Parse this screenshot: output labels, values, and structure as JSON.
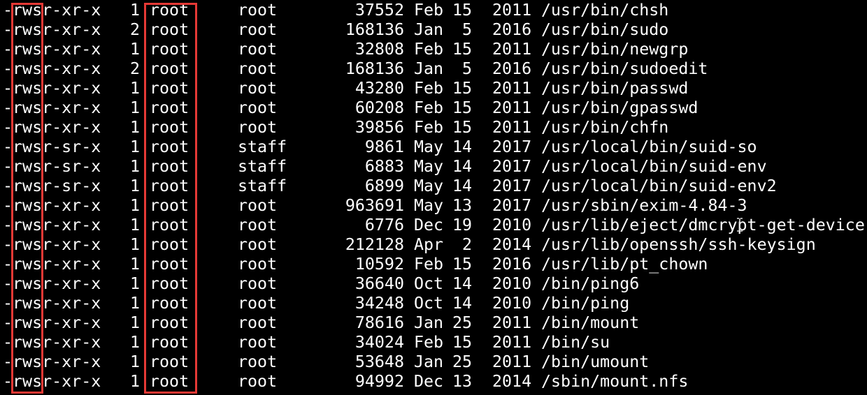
{
  "terminal": {
    "colors": {
      "background": "#000000",
      "text": "#ffffff",
      "highlight": "#e53935"
    },
    "rows": [
      {
        "perm": "-rwsr-xr-x",
        "links": "1",
        "owner": "root",
        "group": "root",
        "size": "37552",
        "month": "Feb",
        "day": "15",
        "year": "2011",
        "path": "/usr/bin/chsh"
      },
      {
        "perm": "-rwsr-xr-x",
        "links": "2",
        "owner": "root",
        "group": "root",
        "size": "168136",
        "month": "Jan",
        "day": "5",
        "year": "2016",
        "path": "/usr/bin/sudo"
      },
      {
        "perm": "-rwsr-xr-x",
        "links": "1",
        "owner": "root",
        "group": "root",
        "size": "32808",
        "month": "Feb",
        "day": "15",
        "year": "2011",
        "path": "/usr/bin/newgrp"
      },
      {
        "perm": "-rwsr-xr-x",
        "links": "2",
        "owner": "root",
        "group": "root",
        "size": "168136",
        "month": "Jan",
        "day": "5",
        "year": "2016",
        "path": "/usr/bin/sudoedit"
      },
      {
        "perm": "-rwsr-xr-x",
        "links": "1",
        "owner": "root",
        "group": "root",
        "size": "43280",
        "month": "Feb",
        "day": "15",
        "year": "2011",
        "path": "/usr/bin/passwd"
      },
      {
        "perm": "-rwsr-xr-x",
        "links": "1",
        "owner": "root",
        "group": "root",
        "size": "60208",
        "month": "Feb",
        "day": "15",
        "year": "2011",
        "path": "/usr/bin/gpasswd"
      },
      {
        "perm": "-rwsr-xr-x",
        "links": "1",
        "owner": "root",
        "group": "root",
        "size": "39856",
        "month": "Feb",
        "day": "15",
        "year": "2011",
        "path": "/usr/bin/chfn"
      },
      {
        "perm": "-rwsr-sr-x",
        "links": "1",
        "owner": "root",
        "group": "staff",
        "size": "9861",
        "month": "May",
        "day": "14",
        "year": "2017",
        "path": "/usr/local/bin/suid-so"
      },
      {
        "perm": "-rwsr-sr-x",
        "links": "1",
        "owner": "root",
        "group": "staff",
        "size": "6883",
        "month": "May",
        "day": "14",
        "year": "2017",
        "path": "/usr/local/bin/suid-env"
      },
      {
        "perm": "-rwsr-sr-x",
        "links": "1",
        "owner": "root",
        "group": "staff",
        "size": "6899",
        "month": "May",
        "day": "14",
        "year": "2017",
        "path": "/usr/local/bin/suid-env2"
      },
      {
        "perm": "-rwsr-xr-x",
        "links": "1",
        "owner": "root",
        "group": "root",
        "size": "963691",
        "month": "May",
        "day": "13",
        "year": "2017",
        "path": "/usr/sbin/exim-4.84-3"
      },
      {
        "perm": "-rwsr-xr-x",
        "links": "1",
        "owner": "root",
        "group": "root",
        "size": "6776",
        "month": "Dec",
        "day": "19",
        "year": "2010",
        "path": "/usr/lib/eject/dmcrypt-get-device"
      },
      {
        "perm": "-rwsr-xr-x",
        "links": "1",
        "owner": "root",
        "group": "root",
        "size": "212128",
        "month": "Apr",
        "day": "2",
        "year": "2014",
        "path": "/usr/lib/openssh/ssh-keysign"
      },
      {
        "perm": "-rwsr-xr-x",
        "links": "1",
        "owner": "root",
        "group": "root",
        "size": "10592",
        "month": "Feb",
        "day": "15",
        "year": "2016",
        "path": "/usr/lib/pt_chown"
      },
      {
        "perm": "-rwsr-xr-x",
        "links": "1",
        "owner": "root",
        "group": "root",
        "size": "36640",
        "month": "Oct",
        "day": "14",
        "year": "2010",
        "path": "/bin/ping6"
      },
      {
        "perm": "-rwsr-xr-x",
        "links": "1",
        "owner": "root",
        "group": "root",
        "size": "34248",
        "month": "Oct",
        "day": "14",
        "year": "2010",
        "path": "/bin/ping"
      },
      {
        "perm": "-rwsr-xr-x",
        "links": "1",
        "owner": "root",
        "group": "root",
        "size": "78616",
        "month": "Jan",
        "day": "25",
        "year": "2011",
        "path": "/bin/mount"
      },
      {
        "perm": "-rwsr-xr-x",
        "links": "1",
        "owner": "root",
        "group": "root",
        "size": "34024",
        "month": "Feb",
        "day": "15",
        "year": "2011",
        "path": "/bin/su"
      },
      {
        "perm": "-rwsr-xr-x",
        "links": "1",
        "owner": "root",
        "group": "root",
        "size": "53648",
        "month": "Jan",
        "day": "25",
        "year": "2011",
        "path": "/bin/umount"
      },
      {
        "perm": "-rwsr-xr-x",
        "links": "1",
        "owner": "root",
        "group": "root",
        "size": "94992",
        "month": "Dec",
        "day": "13",
        "year": "2014",
        "path": "/sbin/mount.nfs"
      }
    ],
    "cursor_icon": "text-cursor-icon"
  }
}
